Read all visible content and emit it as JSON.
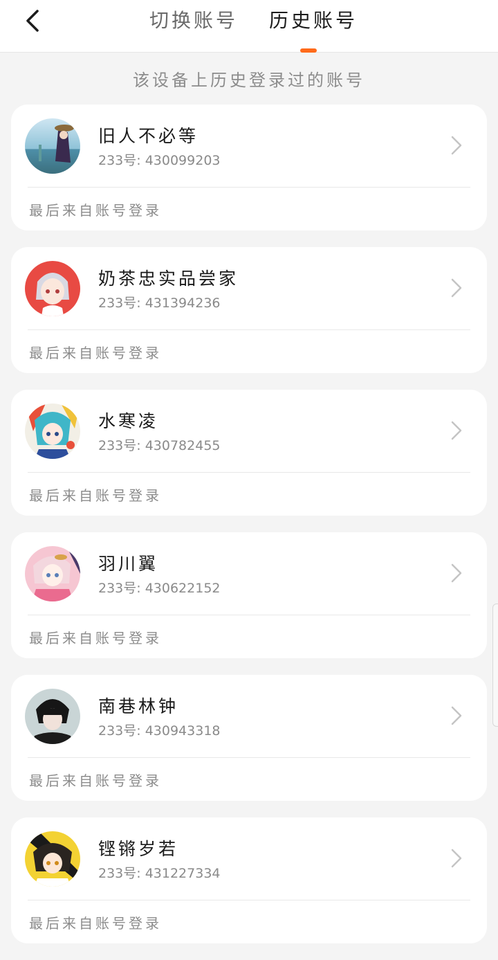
{
  "header": {
    "tabs": [
      {
        "label": "切换账号",
        "active": false
      },
      {
        "label": "历史账号",
        "active": true
      }
    ],
    "accent_color": "#ff6a1a",
    "back_icon": "chevron-left-icon"
  },
  "subtitle": "该设备上历史登录过的账号",
  "accounts": [
    {
      "name": "旧人不必等",
      "uid": "233号: 430099203",
      "source": "最后来自账号登录"
    },
    {
      "name": "奶茶忠实品尝家",
      "uid": "233号: 431394236",
      "source": "最后来自账号登录"
    },
    {
      "name": "水寒凌",
      "uid": "233号: 430782455",
      "source": "最后来自账号登录"
    },
    {
      "name": "羽川翼",
      "uid": "233号: 430622152",
      "source": "最后来自账号登录"
    },
    {
      "name": "南巷林钟",
      "uid": "233号: 430943318",
      "source": "最后来自账号登录"
    },
    {
      "name": "铿锵岁若",
      "uid": "233号: 431227334",
      "source": "最后来自账号登录"
    }
  ]
}
